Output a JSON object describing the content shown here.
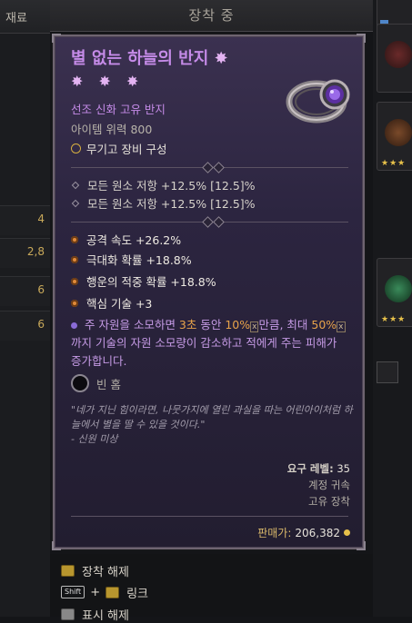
{
  "background": {
    "left_tab_label": "재료",
    "left_values": [
      "4",
      "2,8",
      "6",
      "6"
    ],
    "header_title": "장착 중",
    "bottom_menu": {
      "unequip_label": "장착 해제",
      "shift_key": "Shift",
      "plus": "+",
      "link_label": "링크",
      "third_label": "표시 해제"
    }
  },
  "tooltip": {
    "item_name": "별 없는 하늘의 반지",
    "title_star": "✸",
    "title_stars": "✸ ✸ ✸",
    "subtype": "선조 신화 고유 반지",
    "item_power": "아이템 위력 800",
    "class_req": "무기고 장비 구성",
    "implicits": [
      "모든 원소 저항 +12.5% [12.5]%",
      "모든 원소 저항 +12.5% [12.5]%"
    ],
    "affixes": [
      "공격 속도 +26.2%",
      "극대화 확률 +18.8%",
      "행운의 적중 확률 +18.8%",
      "핵심 기술 +3"
    ],
    "legendary": {
      "part1": "주 자원을 소모하면 ",
      "hi1": "3초",
      "part2": " 동안 ",
      "hi2": "10%",
      "box1": "x",
      "part3": "만큼, 최대 ",
      "hi3": "50%",
      "box2": "x",
      "part4": "까지 기술의 자원 소모량이 감소하고 적에게 주는 피해가 증가합니다."
    },
    "socket_label": "빈 홈",
    "flavor": "\"네가 지닌 힘이라면, 나뭇가지에 열린 과실을 따는 어린아이처럼 하늘에서 별을 딸 수 있을 것이다.\"",
    "flavor_author": "- 신원 미상",
    "req_level_label": "요구 레벨:",
    "req_level_value": "35",
    "bind_account": "계정 귀속",
    "bind_unique": "고유 장착",
    "sell_label": "판매가:",
    "sell_value": "206,382"
  },
  "colors": {
    "mythic": "#c58be8",
    "legendary_text": "#c69be6",
    "highlight": "#e8a34a",
    "affix_bullet": "#e08a3a"
  },
  "icons": [
    "ring-icon",
    "weapon-config-icon",
    "socket-icon",
    "gold-coin-icon",
    "chest-icon",
    "shift-key-icon"
  ]
}
